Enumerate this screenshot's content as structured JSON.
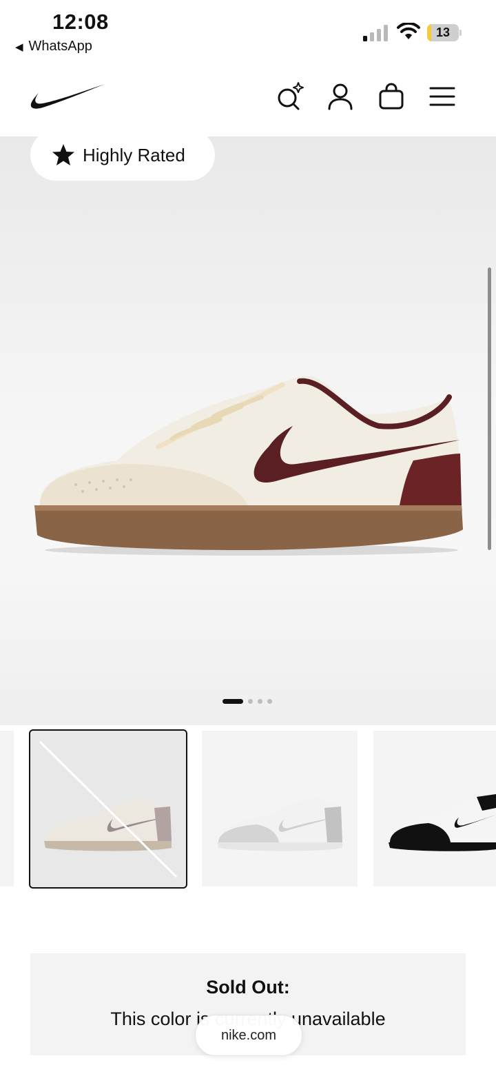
{
  "status_bar": {
    "time": "12:08",
    "back_app": "WhatsApp",
    "battery_percent": 13,
    "battery_label": "13",
    "battery_color": "#f4c93a"
  },
  "header": {
    "logo_icon": "nike-swoosh-icon",
    "icons": [
      "ai-search-icon",
      "account-icon",
      "bag-icon",
      "menu-icon"
    ]
  },
  "hero": {
    "badge_icon": "star-icon",
    "badge_label": "Highly Rated",
    "carousel_total": 4,
    "carousel_active": 1
  },
  "thumbnails": [
    {
      "color": "sail-burgundy",
      "state": "selected-unavailable"
    },
    {
      "color": "white-grey",
      "state": "available"
    },
    {
      "color": "white-black",
      "state": "available"
    }
  ],
  "sold_out": {
    "title": "Sold Out:",
    "message": "This color is currently unavailable"
  },
  "browser": {
    "url": "nike.com"
  },
  "colors": {
    "swoosh": "#5a1f22",
    "sole": "#8a6447",
    "accent_black": "#111111"
  }
}
